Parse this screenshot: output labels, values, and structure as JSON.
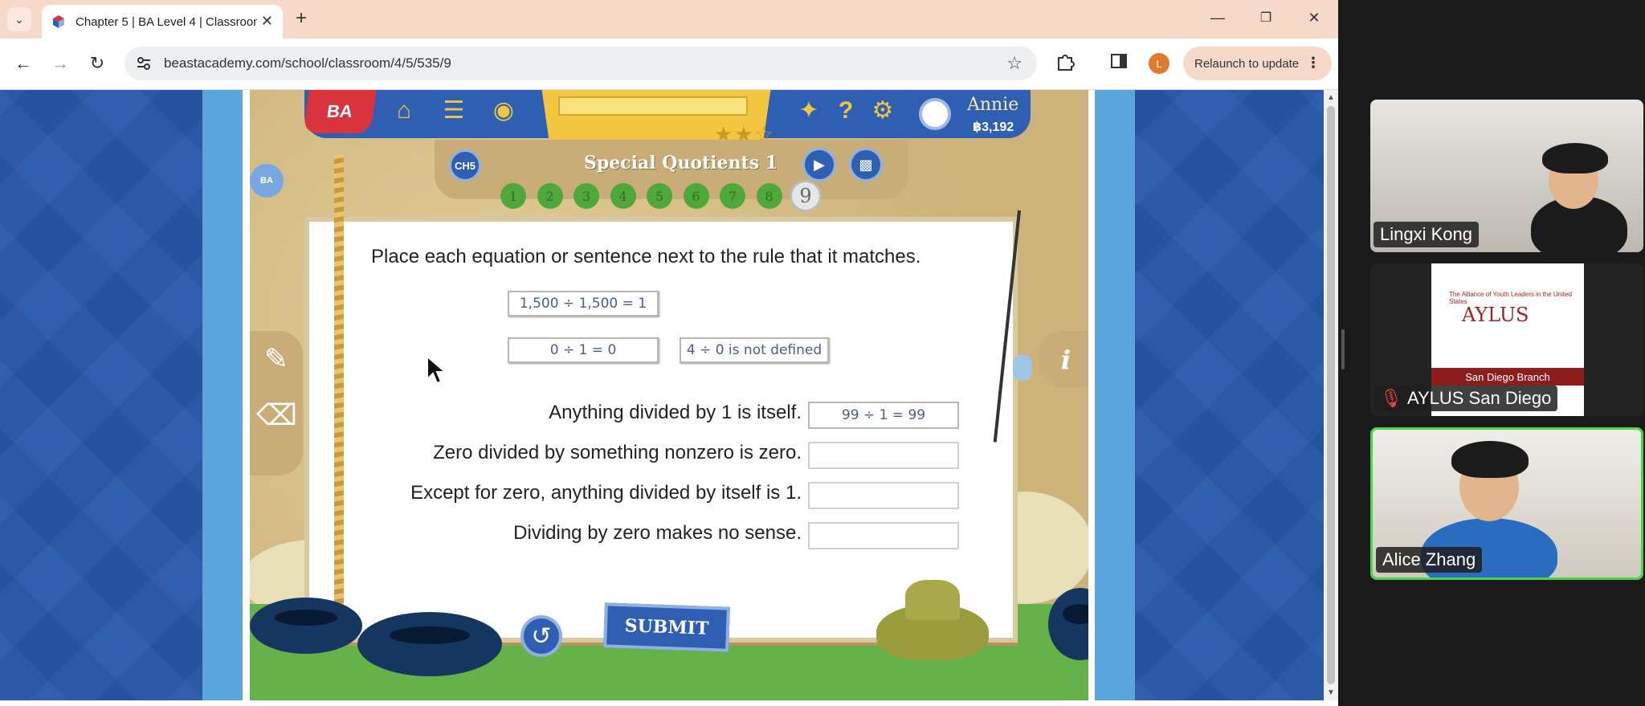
{
  "browser": {
    "tab_title": "Chapter 5 | BA Level 4 | Classroom",
    "url": "beastacademy.com/school/classroom/4/5/535/9",
    "profile_initial": "L",
    "relaunch_label": "Relaunch to update"
  },
  "game": {
    "logo_text": "BA",
    "user_name": "Annie",
    "coins": "฿3,192",
    "chapter_badge": "CH5",
    "side_badge": "BA",
    "lesson_title": "Special Quotients 1",
    "problems": [
      "1",
      "2",
      "3",
      "4",
      "5",
      "6",
      "7",
      "8",
      "9"
    ],
    "current_problem": "9",
    "instruction": "Place each equation or sentence next to the rule that it matches.",
    "tiles": {
      "a": "1,500 ÷ 1,500 = 1",
      "b": "0 ÷ 1 = 0",
      "c": "4 ÷ 0 is not defined"
    },
    "rules": [
      {
        "text": "Anything divided by 1 is itself.",
        "answer": "99 ÷ 1 = 99"
      },
      {
        "text": "Zero divided by something nonzero is zero.",
        "answer": ""
      },
      {
        "text": "Except for zero, anything divided by itself is 1.",
        "answer": ""
      },
      {
        "text": "Dividing by zero makes no sense.",
        "answer": ""
      }
    ],
    "submit_label": "SUBMIT",
    "stars_earned": 2,
    "stars_total": 3
  },
  "zoom": {
    "participants": [
      {
        "name": "Lingxi Kong"
      },
      {
        "name": "AYLUS San Diego",
        "muted": true
      },
      {
        "name": "Alice Zhang",
        "active": true
      }
    ],
    "aylus_card": {
      "title": "AYLUS",
      "subtitle": "The Alliance of Youth Leaders in the United States",
      "branch": "San Diego Branch"
    }
  },
  "colors": {
    "game_blue": "#2e5fb2",
    "page_blue": "#2857a9",
    "accent_gold": "#f2c640",
    "active_speaker": "#4fd34f"
  }
}
